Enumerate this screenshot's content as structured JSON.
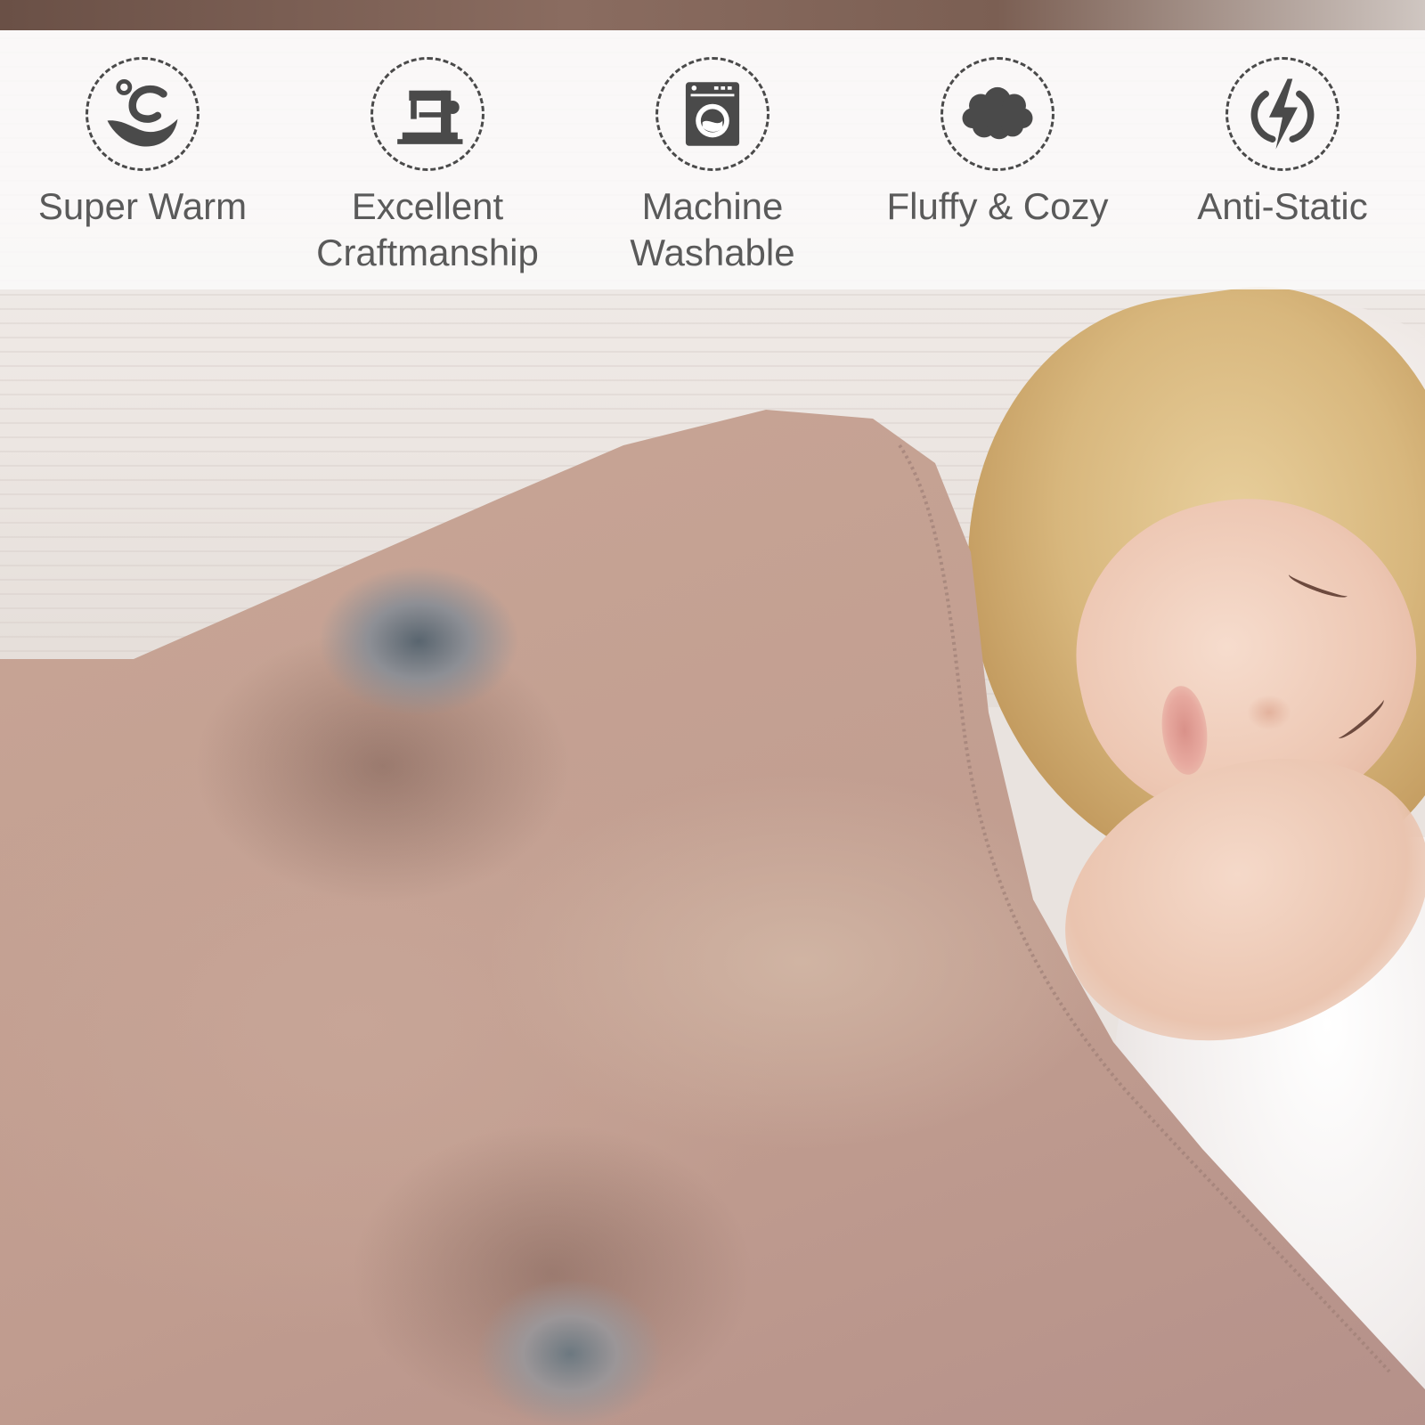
{
  "features": [
    {
      "label": "Super Warm",
      "icon": "warmth-icon"
    },
    {
      "label": "Excellent\nCraftmanship",
      "icon": "sewing-machine-icon"
    },
    {
      "label": "Machine\nWashable",
      "icon": "washing-machine-icon"
    },
    {
      "label": "Fluffy & Cozy",
      "icon": "cloud-icon"
    },
    {
      "label": "Anti-Static",
      "icon": "lightning-icon"
    }
  ],
  "colors": {
    "icon": "#4a4a4a",
    "label": "#5a5a5a",
    "banner": "#faf9f9"
  }
}
